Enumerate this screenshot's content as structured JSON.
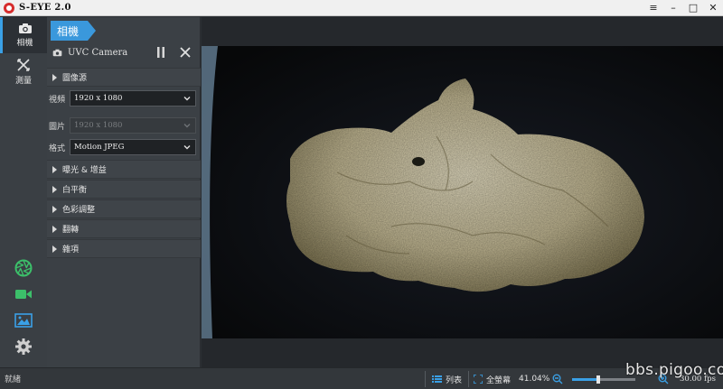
{
  "window": {
    "title": "S-EYE 2.0",
    "controls": [
      "≡",
      "–",
      "□",
      "✕"
    ]
  },
  "rail": {
    "items": [
      {
        "label": "相機",
        "icon": "camera-icon",
        "active": true
      },
      {
        "label": "測量",
        "icon": "measure-icon",
        "active": false
      }
    ],
    "bottom_icons": [
      "capture-shutter-icon",
      "video-record-icon",
      "image-gallery-icon",
      "settings-gear-icon"
    ]
  },
  "panel": {
    "tab_label": "相機",
    "device_name": "UVC Camera",
    "sections": [
      {
        "title": "圖像源"
      },
      {
        "title": "曝光 & 增益"
      },
      {
        "title": "白平衡"
      },
      {
        "title": "色彩調整"
      },
      {
        "title": "翻轉"
      },
      {
        "title": "雜項"
      }
    ],
    "fields": [
      {
        "label": "視頻",
        "value": "1920 x 1080",
        "enabled": true
      },
      {
        "label": "圖片",
        "value": "1920 x 1080",
        "enabled": false
      },
      {
        "label": "格式",
        "value": "Motion JPEG",
        "enabled": true
      }
    ]
  },
  "status": {
    "ready_text": "就緒",
    "list_label": "列表",
    "fullscreen_label": "全螢幕",
    "zoom_percent": "41.04%",
    "zoom_level": 0.42,
    "fps": "30.00 fps",
    "watermark": "bbs.pigoo.com"
  },
  "colors": {
    "accent": "#3a98dc",
    "panel": "#3b4045",
    "rail": "#3a3f44",
    "icon_green": "#3cbf6a",
    "icon_blue": "#3aa0e6"
  }
}
